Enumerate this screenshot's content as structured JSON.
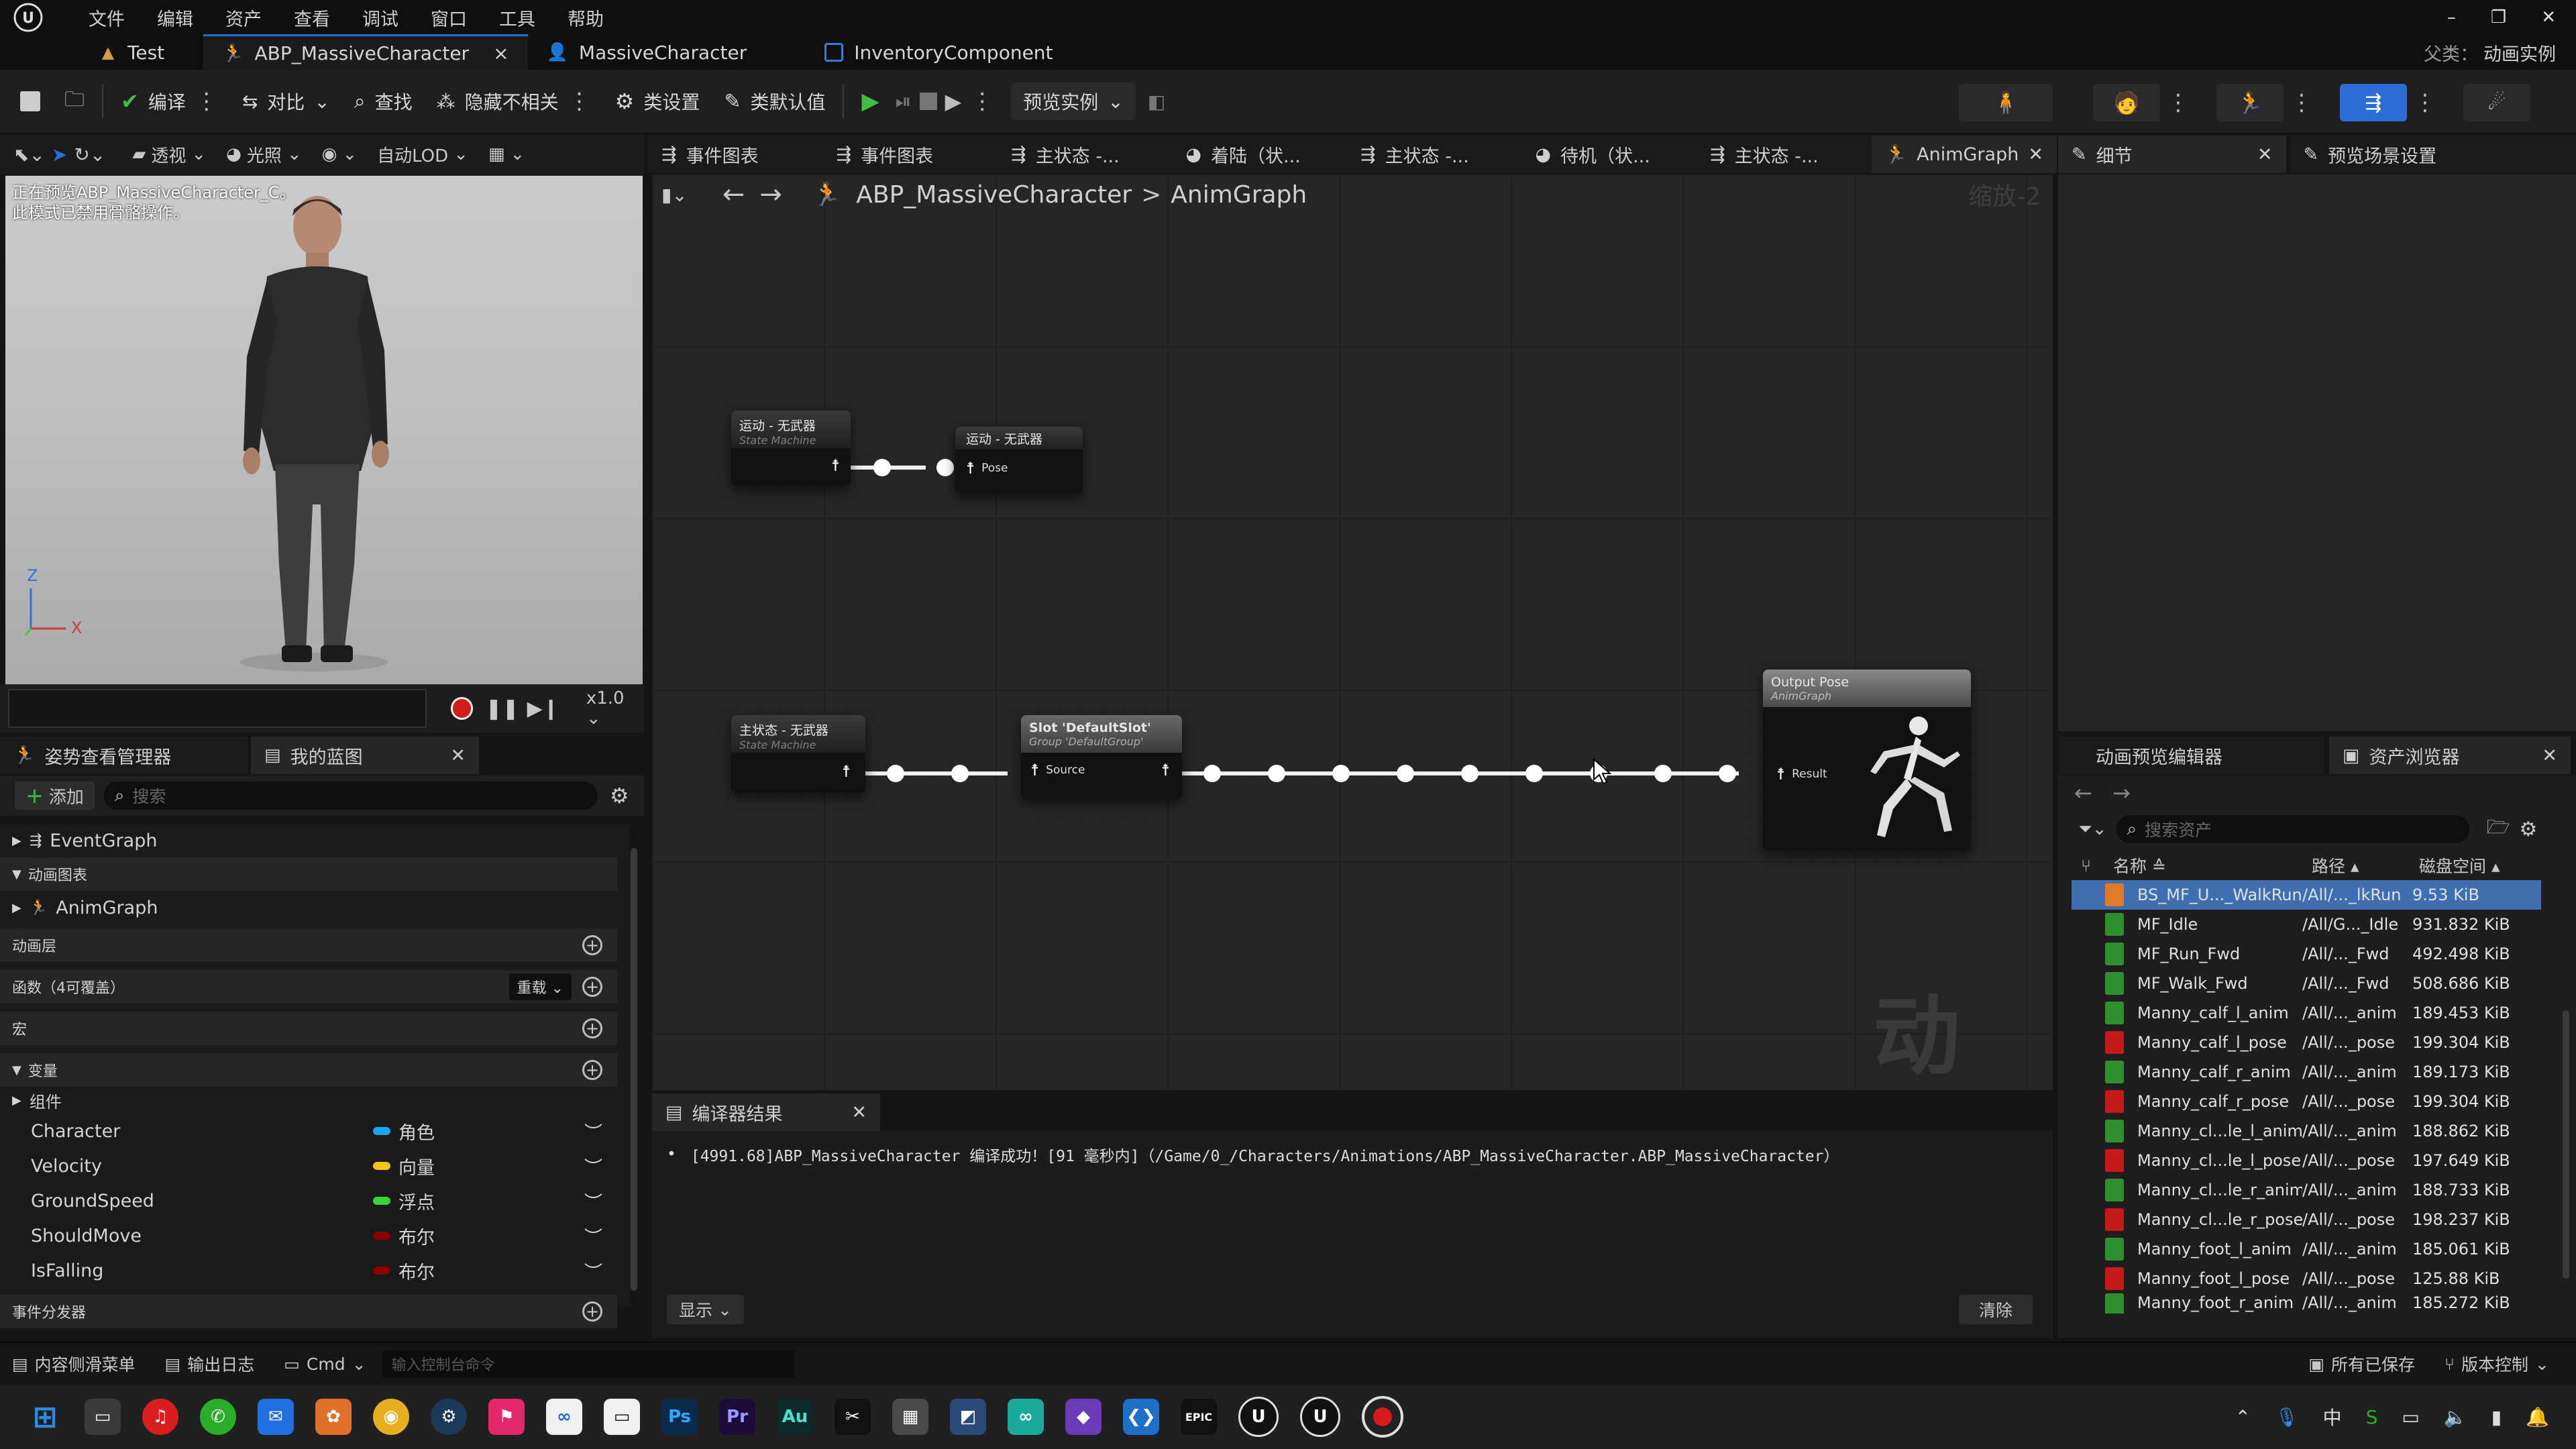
{
  "menu": {
    "items": [
      "文件",
      "编辑",
      "资产",
      "查看",
      "调试",
      "窗口",
      "工具",
      "帮助"
    ]
  },
  "window_controls": {
    "minimize": "–",
    "restore": "❐",
    "close": "✕"
  },
  "doc_tabs": [
    {
      "label": "Test"
    },
    {
      "label": "ABP_MassiveCharacter",
      "close": "×"
    },
    {
      "label": "MassiveCharacter"
    },
    {
      "label": "InventoryComponent"
    }
  ],
  "parent_class": {
    "label": "父类：",
    "value": "动画实例"
  },
  "toolbar": {
    "compile": "编译",
    "diff": "对比",
    "find": "查找",
    "hide_unrelated": "隐藏不相关",
    "class_settings": "类设置",
    "class_defaults": "类默认值",
    "preview_instance": "预览实例"
  },
  "viewport": {
    "buttons": {
      "perspective": "透视",
      "lit": "光照",
      "auto_lod": "自动LOD"
    },
    "overlay_line1": "正在预览ABP_MassiveCharacter_C。",
    "overlay_line2": "此模式已禁用骨骼操作。",
    "axis_z": "Z",
    "axis_x": "X",
    "speed": "x1.0"
  },
  "graph_tabs": [
    "事件图表",
    "事件图表",
    "主状态 -...",
    "着陆（状...",
    "主状态 -...",
    "待机（状...",
    "主状态 -...",
    "AnimGraph"
  ],
  "right_tabs": {
    "details": "细节",
    "preview_scene": "预览场景设置"
  },
  "breadcrumb": {
    "root": "ABP_MassiveCharacter",
    "sep": ">",
    "current": "AnimGraph",
    "zoom": "缩放-2"
  },
  "nodes": {
    "sm1": {
      "title": "运动 - 无武器",
      "sub": "State Machine"
    },
    "cache1": {
      "title": "运动 - 无武器",
      "pin": "Pose"
    },
    "sm2": {
      "title": "主状态 - 无武器",
      "sub": "State Machine"
    },
    "slot": {
      "title": "Slot 'DefaultSlot'",
      "sub": "Group 'DefaultGroup'",
      "pin": "Source"
    },
    "output": {
      "title": "Output Pose",
      "sub": "AnimGraph",
      "pin": "Result"
    }
  },
  "watermark": "动画",
  "left_panel": {
    "tabs": {
      "pose_watch": "姿势查看管理器",
      "my_blueprint": "我的蓝图"
    },
    "add": "添加",
    "search_placeholder": "搜索",
    "event_graph": "EventGraph",
    "cat_anim_graphs": "动画图表",
    "anim_graph": "AnimGraph",
    "cat_anim_layers": "动画层",
    "cat_functions": "函数（4可覆盖）",
    "override": "重载",
    "cat_macros": "宏",
    "cat_variables": "变量",
    "components": "组件",
    "cat_dispatchers": "事件分发器",
    "variables": [
      {
        "name": "Character",
        "type": "角色",
        "color": "#1aa6e8"
      },
      {
        "name": "Velocity",
        "type": "向量",
        "color": "#f2c31c"
      },
      {
        "name": "GroundSpeed",
        "type": "浮点",
        "color": "#38d438"
      },
      {
        "name": "ShouldMove",
        "type": "布尔",
        "color": "#8a0000"
      },
      {
        "name": "IsFalling",
        "type": "布尔",
        "color": "#8a0000"
      }
    ]
  },
  "compiler": {
    "tab": "编译器结果",
    "message": "[4991.68]ABP_MassiveCharacter 编译成功！[91 毫秒内]（/Game/0_/Characters/Animations/ABP_MassiveCharacter.ABP_MassiveCharacter）",
    "show": "显示",
    "clear": "清除"
  },
  "asset_panel": {
    "tabs": {
      "anim_preview": "动画预览编辑器",
      "asset_browser": "资产浏览器"
    },
    "search_placeholder": "搜索资产",
    "columns": {
      "name": "名称",
      "path": "路径",
      "size": "磁盘空间"
    },
    "rows": [
      {
        "name": "BS_MF_U..._WalkRun",
        "path": "/All/..._lkRun",
        "size": "9.53 KiB",
        "kind": "blendspace"
      },
      {
        "name": "MF_Idle",
        "path": "/All/G..._Idle",
        "size": "931.832 KiB",
        "kind": "anim"
      },
      {
        "name": "MF_Run_Fwd",
        "path": "/All/..._Fwd",
        "size": "492.498 KiB",
        "kind": "anim"
      },
      {
        "name": "MF_Walk_Fwd",
        "path": "/All/..._Fwd",
        "size": "508.686 KiB",
        "kind": "anim"
      },
      {
        "name": "Manny_calf_l_anim",
        "path": "/All/..._anim",
        "size": "189.453 KiB",
        "kind": "anim"
      },
      {
        "name": "Manny_calf_l_pose",
        "path": "/All/..._pose",
        "size": "199.304 KiB",
        "kind": "pose"
      },
      {
        "name": "Manny_calf_r_anim",
        "path": "/All/..._anim",
        "size": "189.173 KiB",
        "kind": "anim"
      },
      {
        "name": "Manny_calf_r_pose",
        "path": "/All/..._pose",
        "size": "199.304 KiB",
        "kind": "pose"
      },
      {
        "name": "Manny_cl...le_l_anim",
        "path": "/All/..._anim",
        "size": "188.862 KiB",
        "kind": "anim"
      },
      {
        "name": "Manny_cl...le_l_pose",
        "path": "/All/..._pose",
        "size": "197.649 KiB",
        "kind": "pose"
      },
      {
        "name": "Manny_cl...le_r_anim",
        "path": "/All/..._anim",
        "size": "188.733 KiB",
        "kind": "anim"
      },
      {
        "name": "Manny_cl...le_r_pose",
        "path": "/All/..._pose",
        "size": "198.237 KiB",
        "kind": "pose"
      },
      {
        "name": "Manny_foot_l_anim",
        "path": "/All/..._anim",
        "size": "185.061 KiB",
        "kind": "anim"
      },
      {
        "name": "Manny_foot_l_pose",
        "path": "/All/..._pose",
        "size": "125.88 KiB",
        "kind": "pose"
      },
      {
        "name": "Manny_foot_r_anim",
        "path": "/All/..._anim",
        "size": "185.272 KiB",
        "kind": "anim"
      }
    ]
  },
  "status": {
    "content_drawer": "内容侧滑菜单",
    "output_log": "输出日志",
    "cmd": "Cmd",
    "console_placeholder": "输入控制台命令",
    "all_saved": "所有已保存",
    "source_control": "版本控制"
  },
  "taskbar": {
    "apps": [
      "Ps",
      "Pr",
      "Au"
    ],
    "ime": "中"
  },
  "colors": {
    "accent": "#2c6cd8",
    "play": "#3fbf3f",
    "record": "#d41c1c",
    "anim_asset": "#2f8f2f",
    "pose_asset": "#c41a1a",
    "blendspace_asset": "#e07a2a"
  }
}
